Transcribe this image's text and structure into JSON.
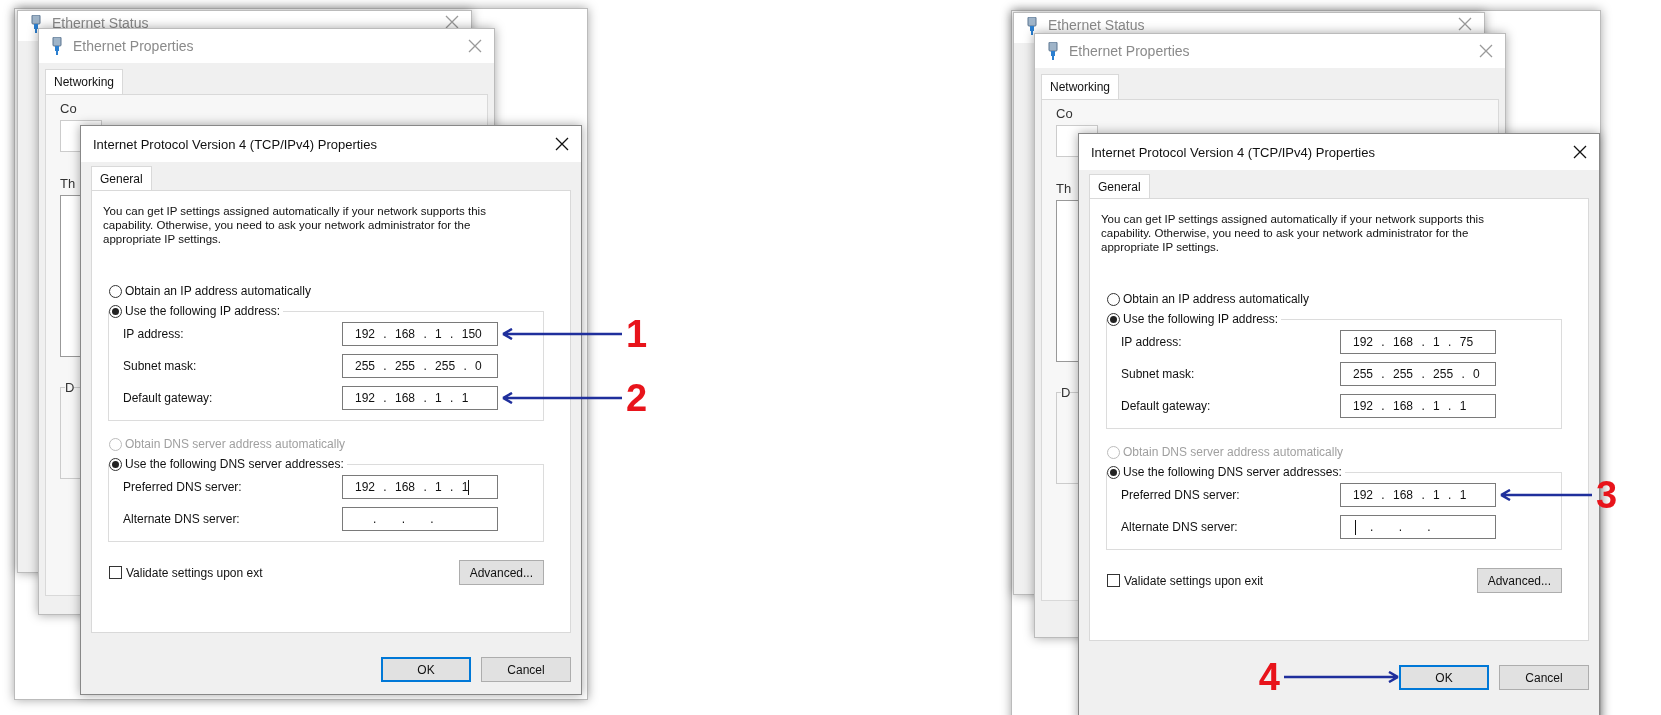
{
  "panels": [
    {
      "status_window": {
        "title": "Ethernet Status"
      },
      "properties_window": {
        "title": "Ethernet Properties",
        "tabs": [
          {
            "label": "Networking",
            "selected": true
          }
        ],
        "connect_label": "Co",
        "components_label": "Th",
        "group_label": "D"
      },
      "ipv4_dialog": {
        "title": "Internet Protocol Version 4 (TCP/IPv4) Properties",
        "tabs": [
          {
            "label": "General",
            "selected": true
          }
        ],
        "description": "You can get IP settings assigned automatically if your network supports this capability. Otherwise, you need to ask your network administrator for the appropriate IP settings.",
        "ip_options": [
          {
            "label": "Obtain an IP address automatically",
            "selected": false,
            "disabled": false
          },
          {
            "label": "Use the following IP address:",
            "selected": true,
            "disabled": false
          }
        ],
        "ip_fields": [
          {
            "label": "IP address:",
            "value": "192 . 168 . 1 . 150",
            "annotation": "1"
          },
          {
            "label": "Subnet mask:",
            "value": "255 . 255 . 255 . 0"
          },
          {
            "label": "Default gateway:",
            "value": "192 . 168 . 1 . 1",
            "annotation": "2"
          }
        ],
        "dns_options": [
          {
            "label": "Obtain DNS server address automatically",
            "selected": false,
            "disabled": true
          },
          {
            "label": "Use the following DNS server addresses:",
            "selected": true,
            "disabled": false
          }
        ],
        "dns_fields": [
          {
            "label": "Preferred DNS server:",
            "value": "192 . 168 . 1 . 1",
            "cursor": true
          },
          {
            "label": "Alternate DNS server:",
            "value": ". . ."
          }
        ],
        "validate": {
          "label": "Validate settings upon ext",
          "checked": false
        },
        "advanced_button": "Advanced...",
        "buttons": [
          {
            "label": "OK",
            "default": true
          },
          {
            "label": "Cancel",
            "default": false
          }
        ]
      }
    },
    {
      "status_window": {
        "title": "Ethernet Status"
      },
      "properties_window": {
        "title": "Ethernet Properties",
        "tabs": [
          {
            "label": "Networking",
            "selected": true
          }
        ],
        "connect_label": "Co",
        "components_label": "Th",
        "group_label": "D"
      },
      "ipv4_dialog": {
        "title": "Internet Protocol Version 4 (TCP/IPv4) Properties",
        "tabs": [
          {
            "label": "General",
            "selected": true
          }
        ],
        "description": "You can get IP settings assigned automatically if your network supports this capability. Otherwise, you need to ask your network administrator for the appropriate IP settings.",
        "ip_options": [
          {
            "label": "Obtain an IP address automatically",
            "selected": false,
            "disabled": false
          },
          {
            "label": "Use the following IP address:",
            "selected": true,
            "disabled": false
          }
        ],
        "ip_fields": [
          {
            "label": "IP address:",
            "value": "192 . 168 . 1 . 75"
          },
          {
            "label": "Subnet mask:",
            "value": "255 . 255 . 255 . 0"
          },
          {
            "label": "Default gateway:",
            "value": "192 . 168 . 1 . 1"
          }
        ],
        "dns_options": [
          {
            "label": "Obtain DNS server address automatically",
            "selected": false,
            "disabled": true
          },
          {
            "label": "Use the following DNS server addresses:",
            "selected": true,
            "disabled": false
          }
        ],
        "dns_fields": [
          {
            "label": "Preferred DNS server:",
            "value": "192 . 168 . 1 . 1",
            "annotation": "3"
          },
          {
            "label": "Alternate DNS server:",
            "value": ". . .",
            "cursor": true
          }
        ],
        "validate": {
          "label": "Validate settings upon exit",
          "checked": false
        },
        "advanced_button": "Advanced...",
        "buttons": [
          {
            "label": "OK",
            "default": true,
            "annotation": "4"
          },
          {
            "label": "Cancel",
            "default": false
          }
        ]
      }
    }
  ]
}
